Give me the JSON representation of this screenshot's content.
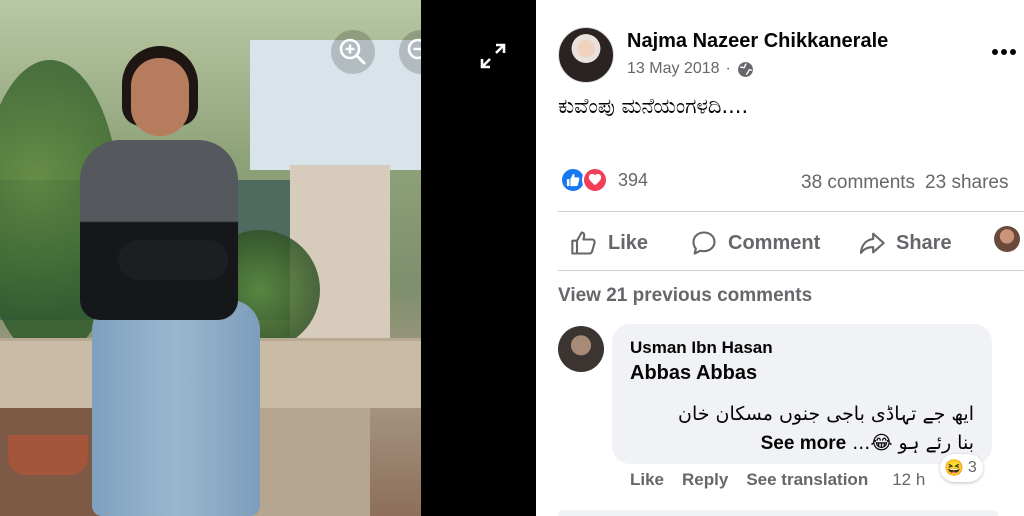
{
  "photo": {
    "zoom_in_label": "",
    "zoom_out_label": "",
    "fullscreen_label": ""
  },
  "post": {
    "author": "Najma Nazeer Chikkanerale",
    "date": "13 May 2018",
    "separator": "·",
    "audience_icon": "globe-icon",
    "text": "ಕುವೆಂಪು ಮನೆಯಂಗಳದಿ....",
    "reactions": {
      "icons": [
        "like-icon",
        "love-icon"
      ],
      "count": "394"
    },
    "comments_count": "38 comments",
    "shares_count": "23 shares"
  },
  "actions": {
    "like": "Like",
    "comment": "Comment",
    "share": "Share"
  },
  "comments": {
    "view_previous": "View 21 previous comments",
    "items": [
      {
        "author": "Usman Ibn Hasan",
        "tag": "Abbas Abbas",
        "text_line1": "ایھ جے تہاڈی باجی جنوں مسکان خان",
        "text_line2": "بنا رئے ہو 😂...",
        "see_more": "See more",
        "reaction_emoji": "😆",
        "reaction_count": "3",
        "like": "Like",
        "reply": "Reply",
        "translate": "See translation",
        "time": "12 h"
      }
    ]
  },
  "colors": {
    "facebook_blue": "#1877f2",
    "love_red": "#f33e58",
    "secondary_text": "#65676b",
    "bubble_bg": "#f0f2f5"
  }
}
